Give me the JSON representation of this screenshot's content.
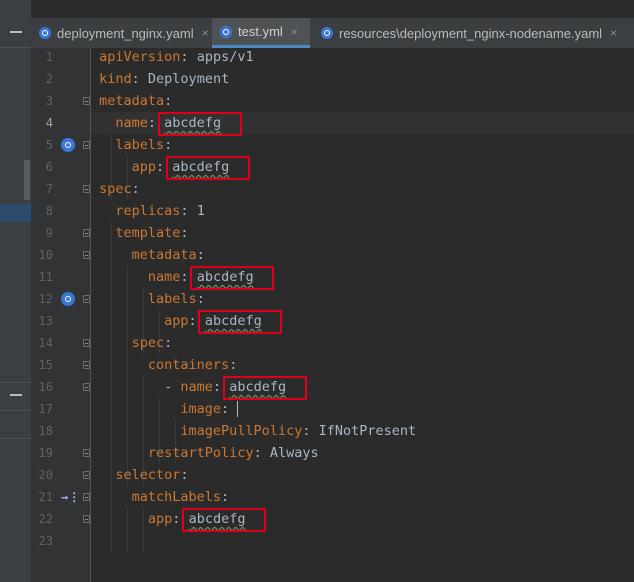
{
  "tabs": [
    {
      "label": "deployment_nginx.yaml",
      "active": false
    },
    {
      "label": "test.yml",
      "active": true
    },
    {
      "label": "resources\\deployment_nginx-nodename.yaml",
      "active": false
    }
  ],
  "close_glyph": "×",
  "current_line": 4,
  "lines": [
    {
      "no": "1",
      "indent": "",
      "key": "apiVersion",
      "sep": ": ",
      "value": "apps/v1"
    },
    {
      "no": "2",
      "indent": "",
      "key": "kind",
      "sep": ": ",
      "value": "Deployment"
    },
    {
      "no": "3",
      "indent": "",
      "key": "metadata",
      "sep": ":",
      "value": ""
    },
    {
      "no": "4",
      "indent": "  ",
      "key": "name",
      "sep": ": ",
      "value": "abcdefg"
    },
    {
      "no": "5",
      "indent": "  ",
      "key": "labels",
      "sep": ":",
      "value": ""
    },
    {
      "no": "6",
      "indent": "    ",
      "key": "app",
      "sep": ": ",
      "value": "abcdefg"
    },
    {
      "no": "7",
      "indent": "",
      "key": "spec",
      "sep": ":",
      "value": ""
    },
    {
      "no": "8",
      "indent": "  ",
      "key": "replicas",
      "sep": ": ",
      "value": "1"
    },
    {
      "no": "9",
      "indent": "  ",
      "key": "template",
      "sep": ":",
      "value": ""
    },
    {
      "no": "10",
      "indent": "    ",
      "key": "metadata",
      "sep": ":",
      "value": ""
    },
    {
      "no": "11",
      "indent": "      ",
      "key": "name",
      "sep": ": ",
      "value": "abcdefg"
    },
    {
      "no": "12",
      "indent": "      ",
      "key": "labels",
      "sep": ":",
      "value": ""
    },
    {
      "no": "13",
      "indent": "        ",
      "key": "app",
      "sep": ": ",
      "value": "abcdefg"
    },
    {
      "no": "14",
      "indent": "    ",
      "key": "spec",
      "sep": ":",
      "value": ""
    },
    {
      "no": "15",
      "indent": "      ",
      "key": "containers",
      "sep": ":",
      "value": ""
    },
    {
      "no": "16",
      "indent": "        - ",
      "key": "name",
      "sep": ": ",
      "value": "abcdefg"
    },
    {
      "no": "17",
      "indent": "          ",
      "key": "image",
      "sep": ": ",
      "value": ""
    },
    {
      "no": "18",
      "indent": "          ",
      "key": "imagePullPolicy",
      "sep": ": ",
      "value": "IfNotPresent"
    },
    {
      "no": "19",
      "indent": "      ",
      "key": "restartPolicy",
      "sep": ": ",
      "value": "Always"
    },
    {
      "no": "20",
      "indent": "  ",
      "key": "selector",
      "sep": ":",
      "value": ""
    },
    {
      "no": "21",
      "indent": "    ",
      "key": "matchLabels",
      "sep": ":",
      "value": ""
    },
    {
      "no": "22",
      "indent": "      ",
      "key": "app",
      "sep": ": ",
      "value": "abcdefg"
    },
    {
      "no": "23",
      "indent": "",
      "key": "",
      "sep": "",
      "value": ""
    }
  ],
  "gutter_icons": [
    {
      "line": 5,
      "icon": "kubernetes-icon"
    },
    {
      "line": 12,
      "icon": "kubernetes-icon"
    },
    {
      "line": 21,
      "icon": "implemented-arrow-icon"
    }
  ],
  "highlighted_lines": [
    4,
    6,
    11,
    13,
    16,
    22
  ],
  "highlight_color": "#e0001b",
  "accent_color": "#4a88c7"
}
